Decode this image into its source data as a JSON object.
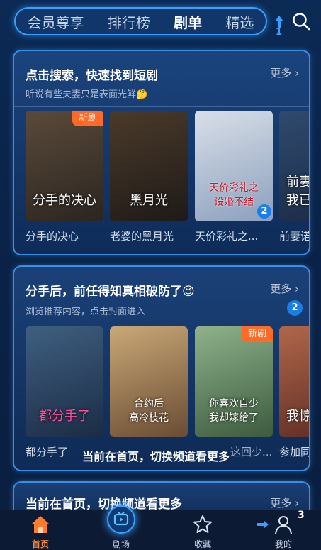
{
  "top_tabs": [
    "会员尊享",
    "排行榜",
    "剧单",
    "精选"
  ],
  "top_badge": "1",
  "section1": {
    "title": "点击搜索，快速找到短剧",
    "subtitle": "听说有些夫妻只是表面光鲜🤔",
    "more": "更多 ›",
    "posters": [
      {
        "title": "分手的决心",
        "text": "分手的决心",
        "tag": "新剧",
        "colors": [
          "#5a4a3a",
          "#2b2520"
        ]
      },
      {
        "title": "老婆的黑月光",
        "text": "黑月光",
        "colors": [
          "#4b3a2a",
          "#1e1a18"
        ]
      },
      {
        "title": "天价彩礼之...",
        "text": "天价彩礼之\n设婚不结",
        "count": "2",
        "colors": [
          "#d9dfe8",
          "#8ba0bd"
        ]
      },
      {
        "title": "前妻诺",
        "text": "前妻\n我已",
        "colors": [
          "#2f4a6e",
          "#1a2a45"
        ]
      }
    ]
  },
  "section2": {
    "title": "分手后，前任得知真相破防了😉",
    "subtitle": "浏览推荐内容，点击封面进入",
    "more": "更多 ›",
    "badge": "2",
    "posters": [
      {
        "title": "都分手了",
        "text": "都分手了",
        "colors": [
          "#3f5f80",
          "#1b2c45"
        ]
      },
      {
        "title": "",
        "text": "合约后\n高冷枝花",
        "colors": [
          "#c9a877",
          "#6a4c33"
        ]
      },
      {
        "title": "这回少...",
        "text": "你喜欢自少\n我却嫁给了",
        "tag": "新剧",
        "colors": [
          "#8fb28a",
          "#3c5b3f"
        ]
      },
      {
        "title": "参加同",
        "text": "我惊",
        "colors": [
          "#b0674a",
          "#5a2a22"
        ]
      }
    ]
  },
  "toast": "当前在首页，切换频道看更多",
  "section3": {
    "title": "当前在首页，切换频道看更多",
    "more": "更多 ›"
  },
  "bottom_nav": [
    {
      "label": "首页",
      "icon": "home-icon",
      "active": true
    },
    {
      "label": "剧场",
      "icon": "theater-icon"
    },
    {
      "label": "收藏",
      "icon": "star-icon"
    },
    {
      "label": "我的",
      "icon": "user-icon"
    }
  ],
  "nav_badge": "3",
  "colors": {
    "accent": "#3aa0ff",
    "active": "#ff8a3c",
    "tag": "#ff6a26"
  }
}
